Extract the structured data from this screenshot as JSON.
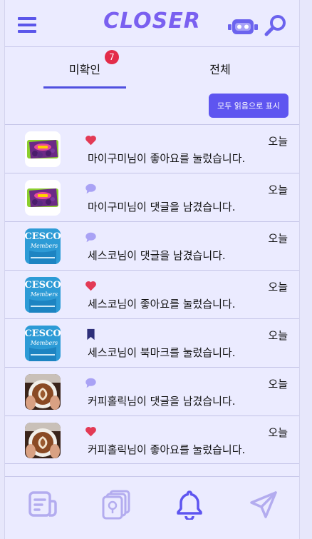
{
  "header": {
    "logo": "CLOSER",
    "menu_icon": "hamburger-menu-icon",
    "robot_icon": "robot-icon",
    "search_icon": "search-icon"
  },
  "tabs": [
    {
      "label": "미확인",
      "badge": "7",
      "active": true
    },
    {
      "label": "전체",
      "active": false
    }
  ],
  "mark_all_label": "모두 읽음으로 표시",
  "notifications": [
    {
      "thumb": "grape-candy",
      "type": "heart",
      "when": "오늘",
      "message": "마이구미님이 좋아요를 눌렀습니다."
    },
    {
      "thumb": "grape-candy",
      "type": "comment",
      "when": "오늘",
      "message": "마이구미님이 댓글을 남겼습니다."
    },
    {
      "thumb": "cesco",
      "type": "comment",
      "when": "오늘",
      "message": "세스코님이 댓글을 남겼습니다."
    },
    {
      "thumb": "cesco",
      "type": "heart",
      "when": "오늘",
      "message": "세스코님이 좋아요를 눌렀습니다."
    },
    {
      "thumb": "cesco",
      "type": "bookmark",
      "when": "오늘",
      "message": "세스코님이 북마크를 눌렀습니다."
    },
    {
      "thumb": "coffee",
      "type": "comment",
      "when": "오늘",
      "message": "커피홀릭님이 댓글을 남겼습니다."
    },
    {
      "thumb": "coffee",
      "type": "heart",
      "when": "오늘",
      "message": "커피홀릭님이 좋아요를 눌렀습니다."
    }
  ],
  "thumb_text": {
    "cesco": "CESCO",
    "cesco_sub": "Members"
  },
  "bottom_nav": [
    {
      "icon": "document-icon",
      "active": false
    },
    {
      "icon": "cards-icon",
      "active": false
    },
    {
      "icon": "bell-icon",
      "active": true
    },
    {
      "icon": "send-icon",
      "active": false
    }
  ],
  "colors": {
    "accent": "#5e55f0",
    "badge": "#e32c4a",
    "heart": "#e33a55",
    "comment": "#a9a2f5",
    "bookmark": "#2e2f7a",
    "inactive_nav": "#b3acef"
  }
}
